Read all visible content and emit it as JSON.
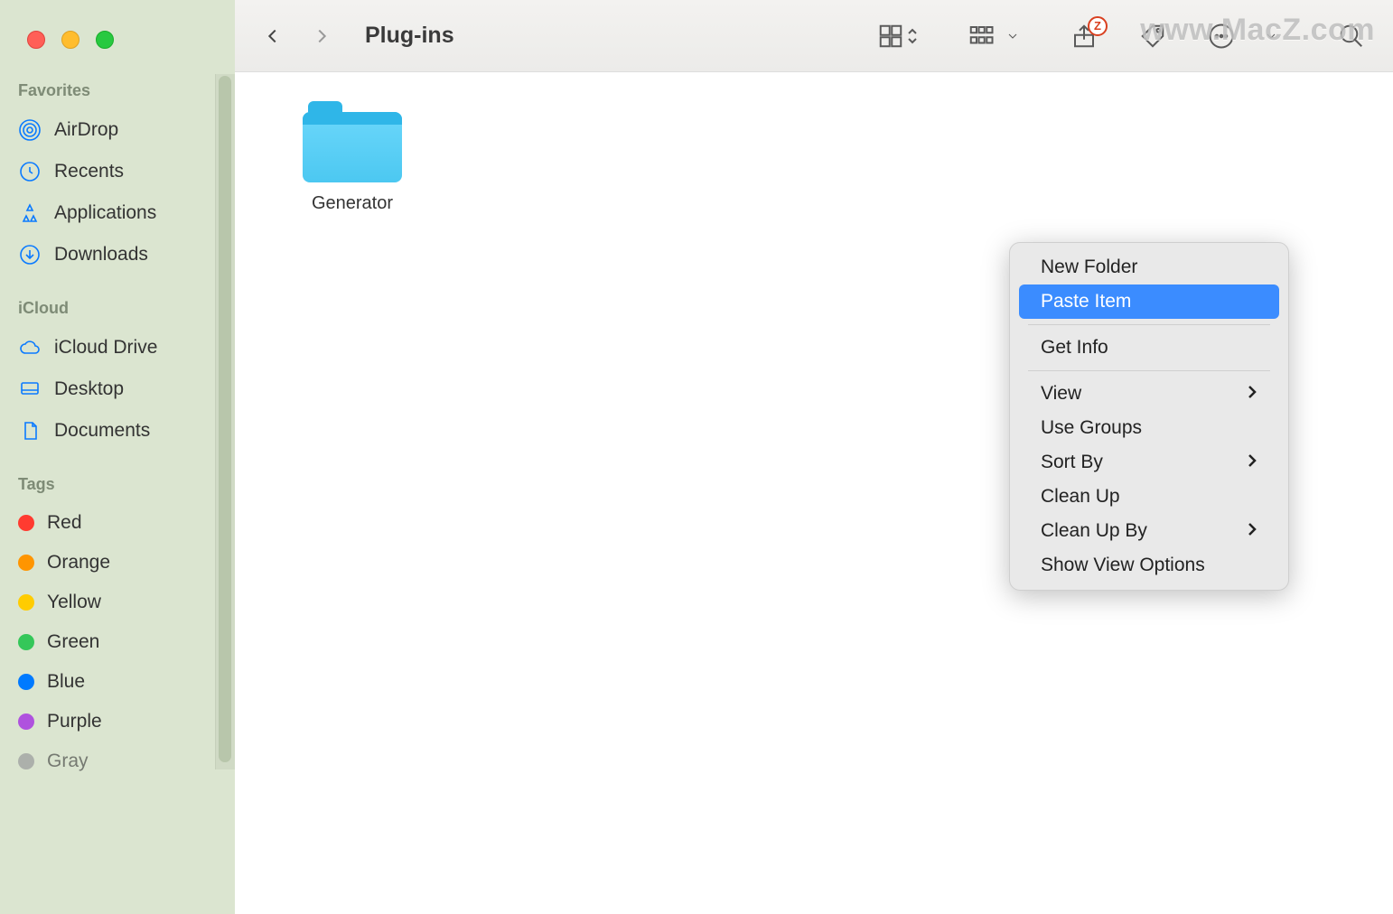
{
  "window": {
    "title": "Plug-ins"
  },
  "watermark": "www.MacZ.com",
  "sidebar": {
    "sections": {
      "favorites": {
        "header": "Favorites",
        "items": [
          {
            "label": "AirDrop",
            "icon": "airdrop-icon"
          },
          {
            "label": "Recents",
            "icon": "clock-icon"
          },
          {
            "label": "Applications",
            "icon": "applications-icon"
          },
          {
            "label": "Downloads",
            "icon": "downloads-icon"
          }
        ]
      },
      "icloud": {
        "header": "iCloud",
        "items": [
          {
            "label": "iCloud Drive",
            "icon": "cloud-icon"
          },
          {
            "label": "Desktop",
            "icon": "desktop-icon"
          },
          {
            "label": "Documents",
            "icon": "document-icon"
          }
        ]
      },
      "tags": {
        "header": "Tags",
        "items": [
          {
            "label": "Red",
            "color": "#ff3b30"
          },
          {
            "label": "Orange",
            "color": "#ff9500"
          },
          {
            "label": "Yellow",
            "color": "#ffcc00"
          },
          {
            "label": "Green",
            "color": "#34c759"
          },
          {
            "label": "Blue",
            "color": "#007aff"
          },
          {
            "label": "Purple",
            "color": "#af52de"
          },
          {
            "label": "Gray",
            "color": "#8e8e93"
          }
        ]
      }
    }
  },
  "content": {
    "items": [
      {
        "name": "Generator",
        "type": "folder"
      }
    ]
  },
  "context_menu": {
    "items": [
      {
        "label": "New Folder",
        "submenu": false,
        "highlight": false
      },
      {
        "label": "Paste Item",
        "submenu": false,
        "highlight": true
      },
      {
        "separator": true
      },
      {
        "label": "Get Info",
        "submenu": false,
        "highlight": false
      },
      {
        "separator": true
      },
      {
        "label": "View",
        "submenu": true,
        "highlight": false
      },
      {
        "label": "Use Groups",
        "submenu": false,
        "highlight": false
      },
      {
        "label": "Sort By",
        "submenu": true,
        "highlight": false
      },
      {
        "label": "Clean Up",
        "submenu": false,
        "highlight": false
      },
      {
        "label": "Clean Up By",
        "submenu": true,
        "highlight": false
      },
      {
        "label": "Show View Options",
        "submenu": false,
        "highlight": false
      }
    ]
  },
  "toolbar": {
    "share_badge": "Z"
  }
}
